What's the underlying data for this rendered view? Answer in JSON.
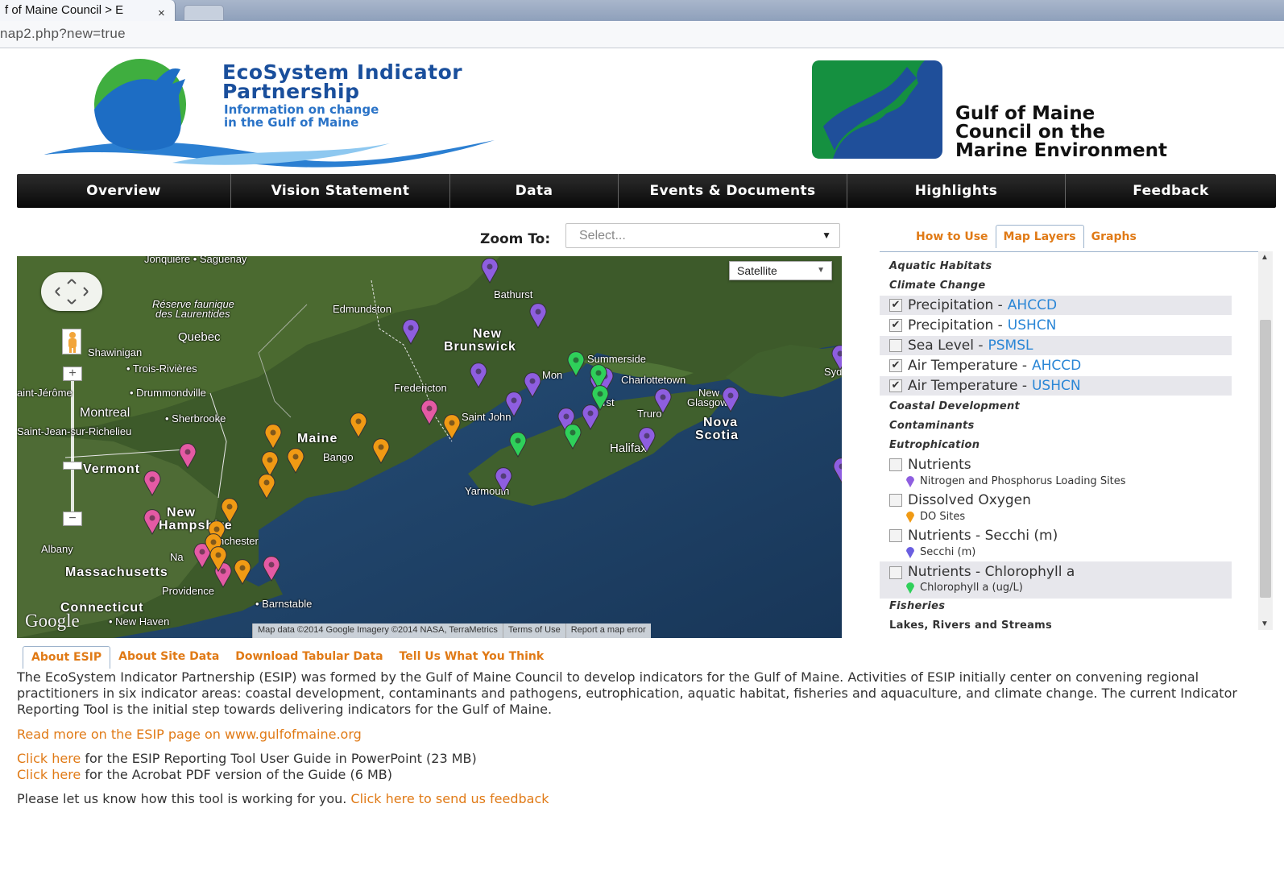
{
  "browser": {
    "tab_title": "f of Maine Council > E",
    "tab_close": "×",
    "url": "nap2.php?new=true"
  },
  "header": {
    "esip_title_line1": "EcoSystem Indicator",
    "esip_title_line2": "Partnership",
    "esip_sub_line1": "Information on change",
    "esip_sub_line2": "in the Gulf of Maine",
    "gom_line1": "Gulf of Maine",
    "gom_line2": "Council on the",
    "gom_line3": "Marine Environment"
  },
  "nav": [
    "Overview",
    "Vision Statement",
    "Data",
    "Events & Documents",
    "Highlights",
    "Feedback"
  ],
  "zoom": {
    "label": "Zoom To:",
    "placeholder": "Select..."
  },
  "map": {
    "type_selector": "Satellite",
    "google_logo": "Google",
    "attribution": [
      "Map data ©2014 Google Imagery ©2014 NASA, TerraMetrics",
      "Terms of Use",
      "Report a map error"
    ],
    "places": {
      "jonquiere": "Jonquière • Saguenay",
      "reserve": "Réserve faunique",
      "laurentides": "des Laurentides",
      "quebec": "Quebec",
      "shawinigan": "Shawinigan",
      "trois": "• Trois-Rivières",
      "stjerome": "aint-Jérôme",
      "drummond": "• Drummondville",
      "montreal": "Montreal",
      "sherbrooke": "• Sherbrooke",
      "stjean": "Saint-Jean-sur-Richelieu",
      "vermont": "Vermont",
      "edmundston": "Edmundston",
      "bathurst": "Bathurst",
      "newbrunswick1": "New",
      "newbrunswick2": "Brunswick",
      "fredericton": "Fredericton",
      "saintjohn": "Saint John",
      "moncton": "Mon",
      "summerside": "Summerside",
      "charlottetown": "Charlottetown",
      "syd": "Syd",
      "amherst": "erst",
      "newglasgow1": "New",
      "newglasgow2": "Glasgow",
      "truro": "Truro",
      "novascotia1": "Nova",
      "novascotia2": "Scotia",
      "halifax": "Halifax",
      "yarmouth": "Yarmouth",
      "maine": "Maine",
      "bangor": "Bango",
      "newhampshire1": "New",
      "newhampshire2": "Hampshire",
      "manchester": "nchester",
      "albany": "Albany",
      "nashua": "Na",
      "massachusetts": "Massachusetts",
      "providence": "Providence",
      "barnstable": "• Barnstable",
      "connecticut": "Connecticut",
      "newhaven": "• New Haven"
    }
  },
  "side_tabs": [
    "How to Use",
    "Map Layers",
    "Graphs"
  ],
  "layers": {
    "cat_aquatic": "Aquatic Habitats",
    "cat_climate": "Climate Change",
    "precip_ahccd": {
      "name": "Precipitation -",
      "src": "AHCCD",
      "checked": "✔"
    },
    "precip_ushcn": {
      "name": "Precipitation -",
      "src": "USHCN",
      "checked": "✔"
    },
    "sea_level": {
      "name": "Sea Level -",
      "src": "PSMSL",
      "checked": ""
    },
    "air_ahccd": {
      "name": "Air Temperature -",
      "src": "AHCCD",
      "checked": "✔"
    },
    "air_ushcn": {
      "name": "Air Temperature -",
      "src": "USHCN",
      "checked": "✔"
    },
    "cat_coastal": "Coastal Development",
    "cat_contaminants": "Contaminants",
    "cat_eutro": "Eutrophication",
    "nutrients": {
      "name": "Nutrients",
      "legend": "Nitrogen and Phosphorus Loading Sites"
    },
    "do": {
      "name": "Dissolved Oxygen",
      "legend": "DO Sites"
    },
    "secchi": {
      "name": "Nutrients - Secchi (m)",
      "legend": "Secchi (m)"
    },
    "chl": {
      "name": "Nutrients - Chlorophyll a",
      "legend": "Chlorophyll a (ug/L)"
    },
    "cat_fisheries": "Fisheries",
    "cat_lakes": "Lakes, Rivers and Streams"
  },
  "colors": {
    "purple_pin": "#8e5ee0",
    "orange_pin": "#f09a14",
    "green_pin": "#2fd05a",
    "pink_pin": "#e45aa4",
    "link": "#e07a16",
    "source_link": "#2a86d6"
  },
  "bottom_tabs": [
    "About ESIP",
    "About Site Data",
    "Download Tabular Data",
    "Tell Us What You Think"
  ],
  "about": {
    "text": "The EcoSystem Indicator Partnership (ESIP) was formed by the Gulf of Maine Council to develop indicators for the Gulf of Maine. Activities of ESIP initially center on convening regional practitioners in six indicator areas: coastal development, contaminants and pathogens, eutrophication, aquatic habitat, fisheries and aquaculture, and climate change. The current Indicator Reporting Tool is the initial step towards delivering indicators for the Gulf of Maine.",
    "read_more": "Read more on the ESIP page on www.gulfofmaine.org",
    "click_here_1": "Click here",
    "guide_ppt": " for the ESIP Reporting Tool User Guide in PowerPoint (23 MB)",
    "click_here_2": "Click here",
    "guide_pdf": " for the Acrobat PDF version of the Guide (6 MB)",
    "feedback_prefix": "Please let us know how this tool is working for you. ",
    "feedback_link": "Click here to send us feedback"
  }
}
